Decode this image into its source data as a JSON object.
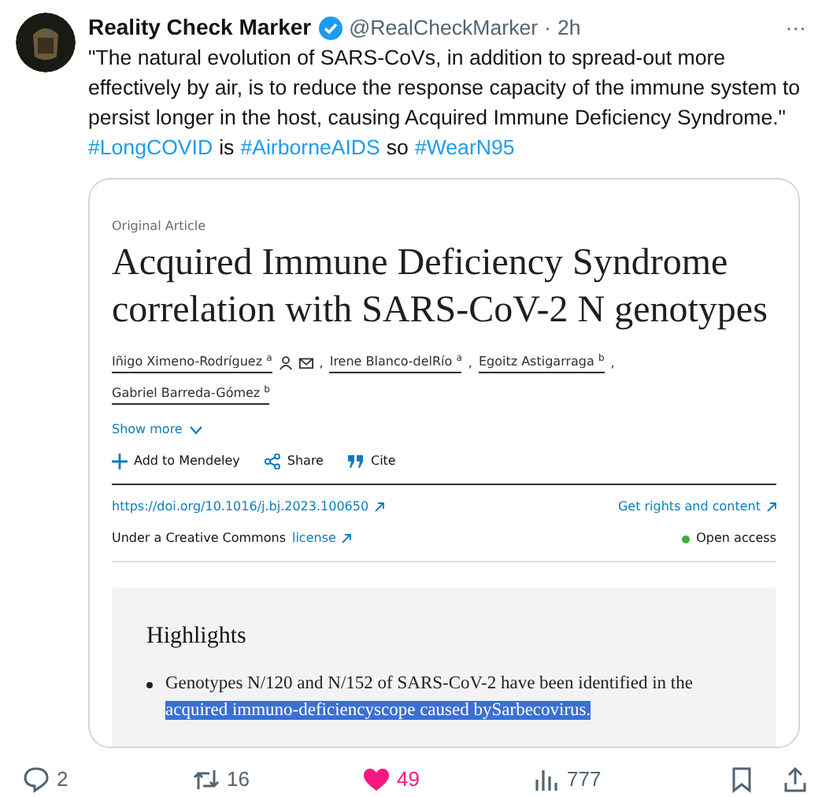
{
  "tweet": {
    "name": "Reality Check Marker",
    "verified": true,
    "handle": "@RealCheckMarker",
    "separator": "·",
    "time": "2h",
    "more": "···",
    "text": "\"The natural evolution of SARS-CoVs, in addition to spread-out more effectively by air, is to reduce the response capacity of the immune system to persist longer in the host, causing Acquired Immune Deficiency Syndrome.\"",
    "tags": [
      {
        "text": "#LongCOVID",
        "kind": "hashtag"
      },
      {
        "text": "is",
        "kind": "word"
      },
      {
        "text": "#AirborneAIDS",
        "kind": "hashtag"
      },
      {
        "text": "so",
        "kind": "word"
      },
      {
        "text": "#WearN95",
        "kind": "hashtag"
      }
    ]
  },
  "article": {
    "label": "Original Article",
    "title": "Acquired Immune Deficiency Syndrome correlation with SARS-CoV-2 N genotypes",
    "authors": [
      {
        "name": "Iñigo Ximeno-Rodríguez $^{a}$",
        "icons": true,
        "comma": ","
      },
      {
        "name": "Irene Blanco-delRío $^{a}$",
        "icons": false,
        "comma": ","
      },
      {
        "name": "Egoitz Astigarraga $^{b}$",
        "icons": false,
        "comma": ","
      },
      {
        "name": "Gabriel Barreda-Gómez $^{b}$",
        "icons": false
      }
    ],
    "show_more": "Show more",
    "actions": [
      {
        "label": "Add to Mendeley",
        "kind": "plus"
      },
      {
        "label": "Share",
        "kind": "share"
      },
      {
        "label": "Cite",
        "kind": "quote"
      }
    ],
    "doi": "https://doi.org/10.1016/j.bj.2023.100650",
    "rights": "Get rights and content",
    "license_text": "Under a Creative Commons",
    "license_link": "license",
    "open_access": "Open access",
    "highlights_title": "Highlights",
    "highlights": [
      {
        "text": "Genotypes N/120 and N/152 of SARS-CoV-2 have been identified in the",
        "selected_text": "acquired immuno-deficiencyscope caused bySarbecovirus."
      }
    ]
  },
  "stats": [
    {
      "kind": "reply",
      "count": "2"
    },
    {
      "kind": "repost",
      "count": "16"
    },
    {
      "kind": "like",
      "count": "49",
      "liked": true
    },
    {
      "kind": "views",
      "count": "777"
    },
    {
      "kind": "bookmark"
    },
    {
      "kind": "share"
    }
  ]
}
